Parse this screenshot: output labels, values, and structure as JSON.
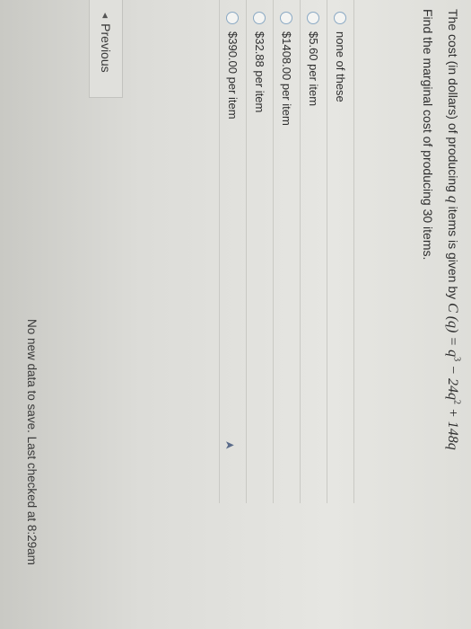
{
  "question": {
    "text_prefix": "The cost (in dollars) of producing ",
    "var_q": "q",
    "text_mid": " items is given by ",
    "formula_lhs": "C (q) = ",
    "formula_t1": "q",
    "exp_3": "3",
    "formula_t2": " − 24q",
    "exp_2": "2",
    "formula_t3": " + 148q",
    "prompt": "Find the marginal cost of producing 30 items."
  },
  "choices": [
    {
      "label": "none of these",
      "selected": false
    },
    {
      "label": "$5.60 per item",
      "selected": false
    },
    {
      "label": "$1408.00 per item",
      "selected": false
    },
    {
      "label": "$32.88 per item",
      "selected": false
    },
    {
      "label": "$390.00 per item",
      "selected": false
    }
  ],
  "nav": {
    "previous_label": "Previous"
  },
  "status": {
    "text": "No new data to save. Last checked at 8:29am"
  },
  "colors": {
    "radio_border": "#8aa9c4",
    "background": "#e2e2de"
  },
  "icons": {
    "previous": "left-triangle-icon",
    "cursor": "mouse-cursor-icon"
  }
}
